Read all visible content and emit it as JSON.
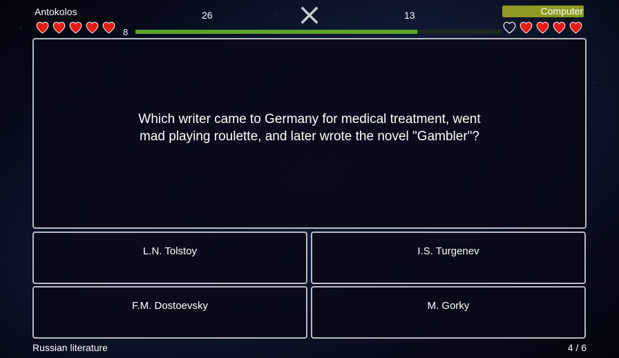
{
  "players": {
    "left": {
      "name": "Antokolos",
      "lives_full": 5,
      "lives_total": 5,
      "small_score": "8",
      "score": "26",
      "progress": 0.77
    },
    "right": {
      "name": "Computer",
      "lives_full": 4,
      "lives_total": 5,
      "score": "13"
    }
  },
  "icons": {
    "close": "close-icon",
    "heart": "heart-icon"
  },
  "colors": {
    "heart": "#e51b16",
    "progress": "#59a52c",
    "computer_label_bg": "#8f9a22"
  },
  "question": {
    "text": "Which writer came to Germany for medical treatment, went mad playing roulette, and later wrote the novel \"Gambler\"?"
  },
  "answers": [
    {
      "label": "L.N. Tolstoy"
    },
    {
      "label": "I.S. Turgenev"
    },
    {
      "label": "F.M. Dostoevsky"
    },
    {
      "label": "M. Gorky"
    }
  ],
  "footer": {
    "category": "Russian literature",
    "counter": "4 / 6"
  }
}
